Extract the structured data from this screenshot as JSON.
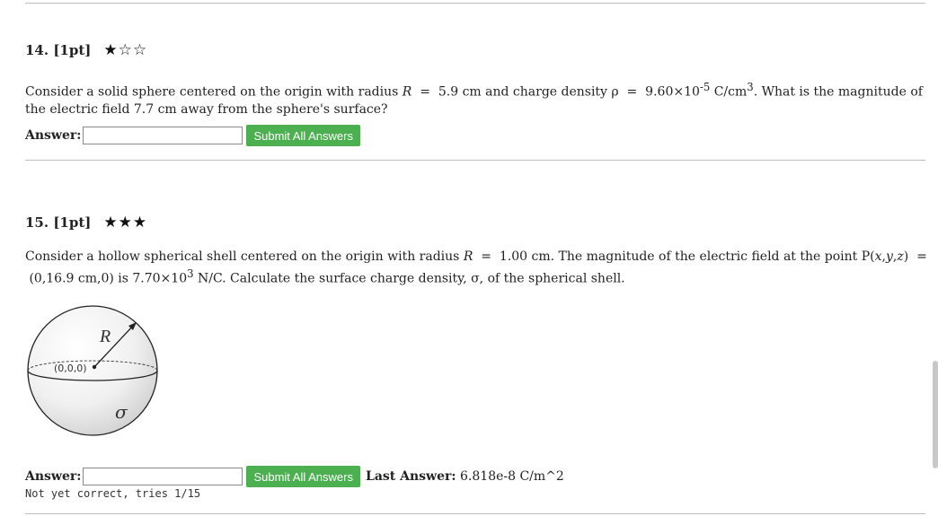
{
  "q14": {
    "title": "14. [1pt]",
    "stars": {
      "filled": "★",
      "empty": "☆☆"
    },
    "text_html": "Consider a solid sphere centered on the origin with radius <i>R</i> &nbsp;= &nbsp;5.9 cm and charge density ρ &nbsp;= &nbsp;9.60×10<sup>-5</sup> C/cm<sup>3</sup>. What is the magnitude of the electric field 7.7 cm away from the sphere's surface?",
    "answer_label": "Answer:",
    "submit_label": "Submit All Answers"
  },
  "q15": {
    "title": "15. [1pt]",
    "stars": {
      "filled": "★★★",
      "empty": ""
    },
    "text_html": "Consider a hollow spherical shell centered on the origin with radius <i>R</i> &nbsp;= &nbsp;1.00 cm. The magnitude of the electric field at the point P(<i>x</i>,<i>y</i>,<i>z</i>) &nbsp;= &nbsp;(0,16.9 cm,0) is 7.70×10<sup>3</sup> N/C. Calculate the surface charge density, σ, of the spherical shell.",
    "diagram": {
      "radius_label": "R",
      "origin_label": "(0,0,0)",
      "sigma_label": "σ"
    },
    "answer_label": "Answer:",
    "submit_label": "Submit All Answers",
    "last_answer_label": "Last Answer:",
    "last_answer_value": "6.818e-8 C/m^2",
    "status_text": "Not yet correct, tries 1/15"
  },
  "colors": {
    "submit_bg": "#4caf50",
    "divider": "#bdbdbd"
  },
  "icons": {
    "star": "star-icon"
  }
}
